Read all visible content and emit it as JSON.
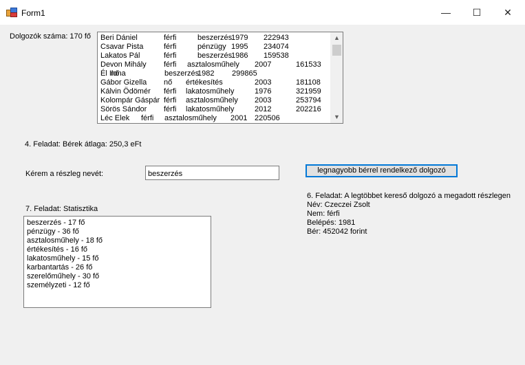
{
  "window": {
    "title": "Form1",
    "minimize": "—",
    "maximize": "☐",
    "close": "✕"
  },
  "labels": {
    "employee_count": "Dolgozók száma: 170 fő",
    "task4": "4. Feladat: Bérek átlaga: 250,3 eFt",
    "department_prompt": "Kérem a részleg nevét:",
    "task7": "7. Feladat: Statisztika"
  },
  "department_input": {
    "value": "beszerzés"
  },
  "highest_salary_button": {
    "label": "legnagyobb bérrel rendelkező dolgozó"
  },
  "employees": [
    {
      "name": "Beri Dániel",
      "gender": "férfi",
      "department": "beszerzés",
      "year": "1979",
      "salary": "222943"
    },
    {
      "name": "Csavar Pista",
      "gender": "férfi",
      "department": "pénzügy",
      "year": "1995",
      "salary": "234074"
    },
    {
      "name": "Lakatos Pál",
      "gender": "férfi",
      "department": "beszerzés",
      "year": "1986",
      "salary": "159538"
    },
    {
      "name": "Devon Mihály",
      "gender": "férfi",
      "department": "asztalosműhely",
      "year": "2007",
      "salary": "161533"
    },
    {
      "name": "Él Ilona",
      "gender": "nő",
      "department": "beszerzés",
      "year": "1982",
      "salary": "299865"
    },
    {
      "name": "Gábor Gizella",
      "gender": "nő",
      "department": "értékesítés",
      "year": "2003",
      "salary": "181108"
    },
    {
      "name": "Kálvin Ödömér",
      "gender": "férfi",
      "department": "lakatosműhely",
      "year": "1976",
      "salary": "321959"
    },
    {
      "name": "Kolompár Gáspár",
      "gender": "férfi",
      "department": "asztalosműhely",
      "year": "2003",
      "salary": "253794"
    },
    {
      "name": "Sörös Sándor",
      "gender": "férfi",
      "department": "lakatosműhely",
      "year": "2012",
      "salary": "202216"
    },
    {
      "name": "Léc Elek",
      "gender": "férfi",
      "department": "asztalosműhely",
      "year": "2001",
      "salary": "220506"
    }
  ],
  "statistics": [
    "beszerzés - 17 fő",
    "pénzügy - 36 fő",
    "asztalosműhely - 18 fő",
    "értékesítés - 16 fő",
    "lakatosműhely - 15 fő",
    "karbantartás - 26 fő",
    "szerelőműhely - 30 fő",
    "személyzeti - 12 fő"
  ],
  "task6": {
    "title": "6. Feladat: A legtöbbet kereső dolgozó a megadott részlegen",
    "name": "Név: Czeczei Zsolt",
    "gender": "Nem: férfi",
    "entry": "Belépés: 1981",
    "salary": "Bér: 452042 forint"
  }
}
